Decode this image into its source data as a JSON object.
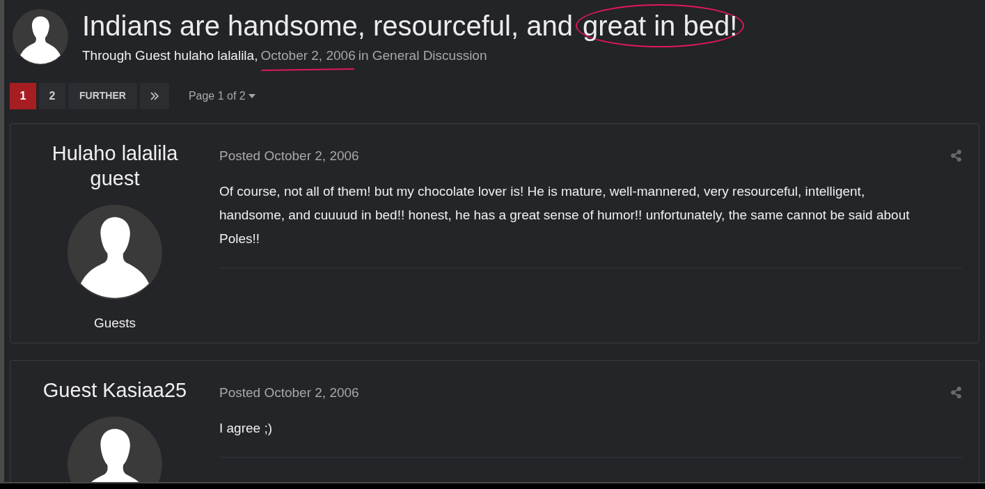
{
  "topic": {
    "title_parts": [
      {
        "text": "Indians are handsome, resourceful, and",
        "circled": false
      },
      {
        "text": "great in bed!",
        "circled": true
      }
    ],
    "byline": {
      "prefix": "Through Guest hulaho lalalila,",
      "date": "October 2, 2006",
      "date_underlined": true,
      "suffix": "in General Discussion"
    }
  },
  "pagination": {
    "pages": [
      {
        "label": "1",
        "selected": true
      },
      {
        "label": "2",
        "selected": false
      }
    ],
    "next": "FURTHER",
    "page_menu": "Page 1 of 2"
  },
  "posts": [
    {
      "author": "Hulaho lalalila guest",
      "group": "Guests",
      "posted": "Posted October 2, 2006",
      "body": "Of course, not all of them! but my chocolate lover is! He is mature, well-mannered, very resourceful, intelligent, handsome, and cuuuud in bed!! honest, he has a great sense of humor!! unfortunately, the same cannot be said about Poles!!"
    },
    {
      "author": "Guest Kasiaa25",
      "posted": "Posted October 2, 2006",
      "body": "I agree ;)"
    }
  ]
}
